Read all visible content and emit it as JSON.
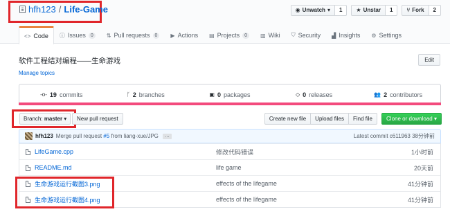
{
  "repo": {
    "owner": "hfh123",
    "separator": "/",
    "name": "Life-Game"
  },
  "actions": [
    {
      "label": "Unwatch",
      "icon": "eye-icon",
      "count": "1"
    },
    {
      "label": "Unstar",
      "icon": "star-icon",
      "count": "1"
    },
    {
      "label": "Fork",
      "icon": "fork-icon",
      "count": "2"
    }
  ],
  "tabs": [
    {
      "label": "Code",
      "icon": "code-icon",
      "badge": ""
    },
    {
      "label": "Issues",
      "icon": "issue-icon",
      "badge": "0"
    },
    {
      "label": "Pull requests",
      "icon": "pull-request-icon",
      "badge": "0"
    },
    {
      "label": "Actions",
      "icon": "play-icon",
      "badge": ""
    },
    {
      "label": "Projects",
      "icon": "project-icon",
      "badge": "0"
    },
    {
      "label": "Wiki",
      "icon": "book-icon",
      "badge": ""
    },
    {
      "label": "Security",
      "icon": "shield-icon",
      "badge": ""
    },
    {
      "label": "Insights",
      "icon": "graph-icon",
      "badge": ""
    },
    {
      "label": "Settings",
      "icon": "gear-icon",
      "badge": ""
    }
  ],
  "description": "软件工程结对编程——生命游戏",
  "manage_topics": "Manage topics",
  "edit_label": "Edit",
  "summary": {
    "commits_count": "19",
    "commits_label": "commits",
    "branches_count": "2",
    "branches_label": "branches",
    "packages_count": "0",
    "packages_label": "packages",
    "releases_count": "0",
    "releases_label": "releases",
    "contributors_count": "2",
    "contributors_label": "contributors"
  },
  "branch": {
    "prefix": "Branch:",
    "name": "master"
  },
  "new_pr_label": "New pull request",
  "file_buttons": [
    "Create new file",
    "Upload files",
    "Find file"
  ],
  "clone_label": "Clone or download",
  "commit": {
    "author": "hfh123",
    "msg_before": "Merge pull request",
    "pr": "#5",
    "msg_after": "from liang-xue/JPG",
    "dots": "…",
    "latest": "Latest commit c611963 38分钟前"
  },
  "files": [
    {
      "name": "LifeGame.cpp",
      "message": "修改代码错误",
      "age": "1小时前"
    },
    {
      "name": "README.md",
      "message": "life game",
      "age": "20天前"
    },
    {
      "name": "生命游戏运行截图3.png",
      "message": "effects of the lifegame",
      "age": "41分钟前"
    },
    {
      "name": "生命游戏运行截图4.png",
      "message": "effects of the lifegame",
      "age": "41分钟前"
    }
  ],
  "colors": {
    "accent": "#0366d6",
    "highlight": "#e0262b",
    "lang_bar": "#f34b7d",
    "clone": "#28a745"
  }
}
